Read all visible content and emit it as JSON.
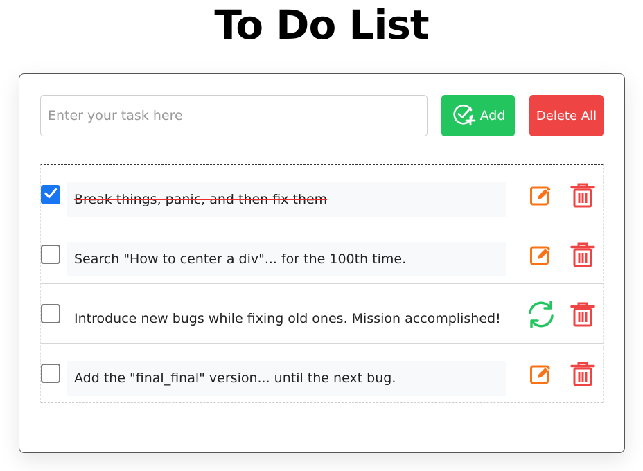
{
  "page": {
    "title": "To Do List"
  },
  "form": {
    "placeholder": "Enter your task here",
    "value": "",
    "add_label": "Add",
    "delete_all_label": "Delete All"
  },
  "colors": {
    "add_green": "#22c55e",
    "delete_red": "#ef4444",
    "edit_orange": "#f97316",
    "refresh_green": "#22c55e",
    "check_blue": "#1976f2",
    "strike_red": "#ef2d2d"
  },
  "tasks": [
    {
      "text": "Break things, panic, and then fix them",
      "checked": true,
      "action_icon": "edit-icon"
    },
    {
      "text": "Search \"How to center a div\"... for the 100th time.",
      "checked": false,
      "action_icon": "edit-icon"
    },
    {
      "text": "Introduce new bugs while fixing old ones. Mission accomplished!",
      "checked": false,
      "action_icon": "refresh-icon"
    },
    {
      "text": "Add the \"final_final\" version... until the next bug.",
      "checked": false,
      "action_icon": "edit-icon"
    }
  ]
}
